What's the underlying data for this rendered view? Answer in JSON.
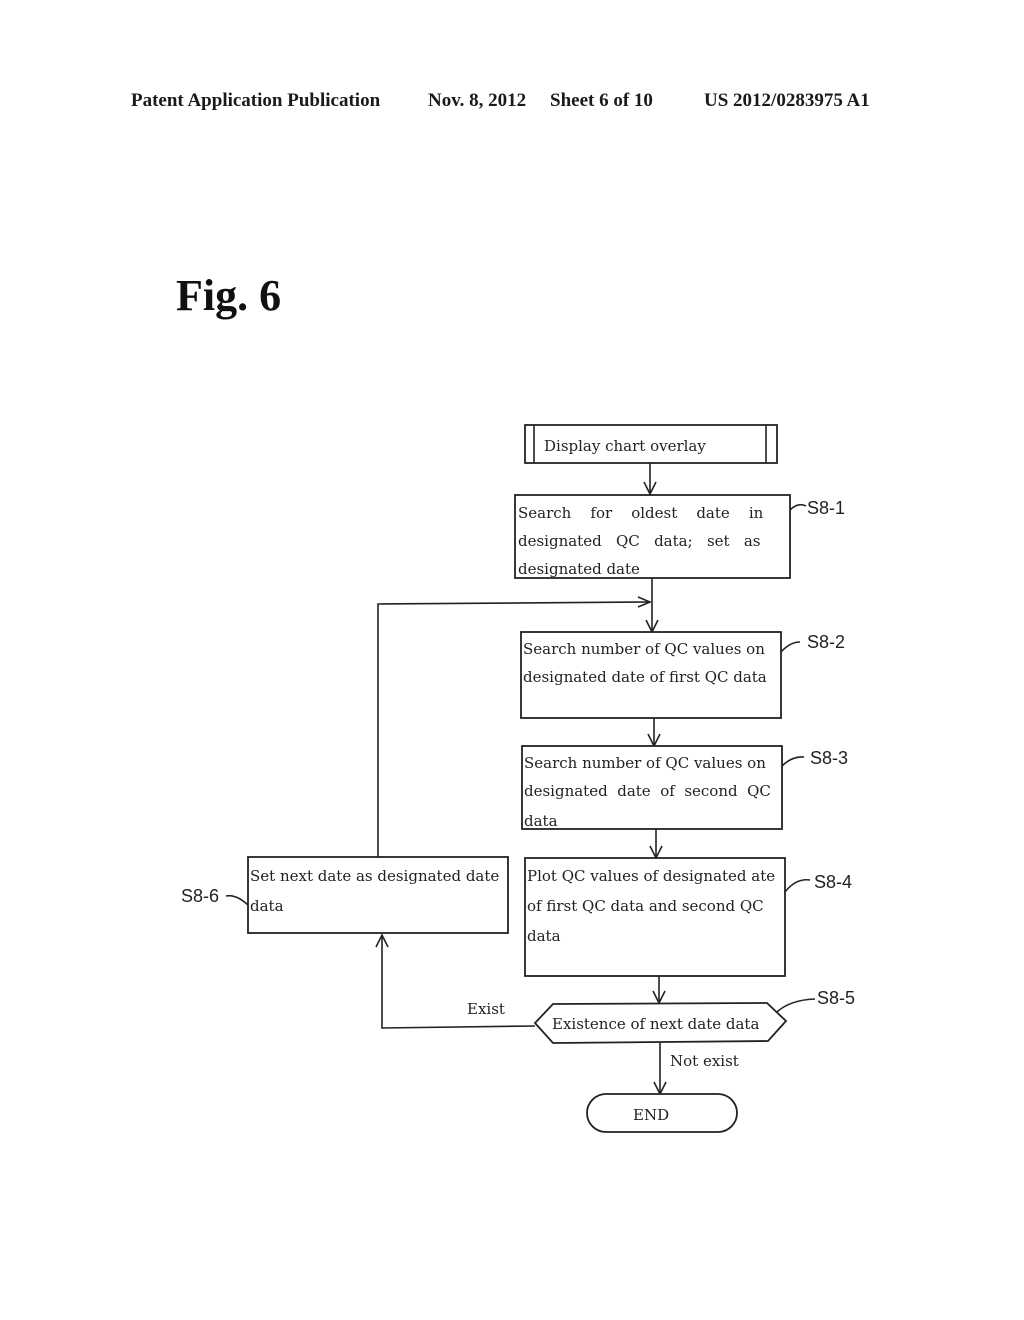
{
  "header": {
    "publication": "Patent Application Publication",
    "date": "Nov. 8, 2012",
    "sheet": "Sheet 6 of 10",
    "number": "US 2012/0283975 A1"
  },
  "figure": {
    "title": "Fig. 6"
  },
  "flowchart": {
    "start": {
      "text": "Display chart overlay"
    },
    "steps": [
      {
        "id": "S8-1",
        "lines": [
          "Search    for    oldest    date    in",
          "designated   QC   data;   set   as",
          "designated date"
        ]
      },
      {
        "id": "S8-2",
        "lines": [
          "Search number of QC values on",
          "designated date of first QC data"
        ]
      },
      {
        "id": "S8-3",
        "lines": [
          "Search number of QC values on",
          "designated  date  of  second  QC",
          "data"
        ]
      },
      {
        "id": "S8-4",
        "lines": [
          "Plot QC values of designated ate",
          "of first QC data and second QC",
          "data"
        ]
      },
      {
        "id": "S8-6",
        "lines": [
          "Set next date as designated date",
          "data"
        ]
      }
    ],
    "decision": {
      "id": "S8-5",
      "text": "Existence of next date data",
      "yes_label": "Exist",
      "no_label": "Not exist"
    },
    "end": {
      "text": "END"
    }
  }
}
